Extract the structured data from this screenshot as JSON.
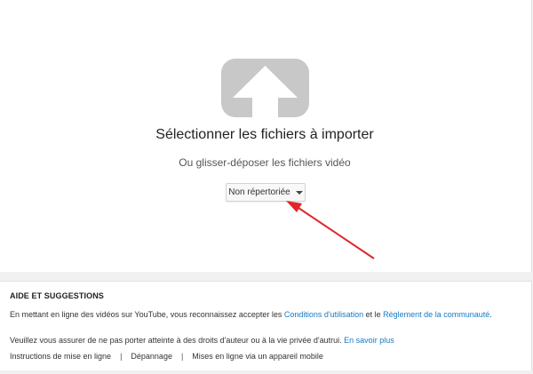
{
  "upload": {
    "title": "Sélectionner les fichiers à importer",
    "subtitle": "Ou glisser-déposer les fichiers vidéo",
    "privacy_value": "Non répertoriée",
    "icon": "upload-arrow-icon"
  },
  "annotation": {
    "arrow_color": "#e0262a"
  },
  "help": {
    "title": "AIDE ET SUGGESTIONS",
    "line1_text": "En mettant en ligne des vidéos sur YouTube, vous reconnaissez accepter les ",
    "terms_link": "Conditions d'utilisation",
    "line1_and": " et le ",
    "guidelines_link": "Règlement de la communauté",
    "line1_end": ".",
    "line2_text": "Veuillez vous assurer de ne pas porter atteinte à des droits d'auteur ou à la vie privée d'autrui. ",
    "learn_more_link": "En savoir plus",
    "footer_links": [
      "Instructions de mise en ligne",
      "Dépannage",
      "Mises en ligne via un appareil mobile"
    ],
    "separator": "|",
    "link_color": "#167ac6"
  }
}
